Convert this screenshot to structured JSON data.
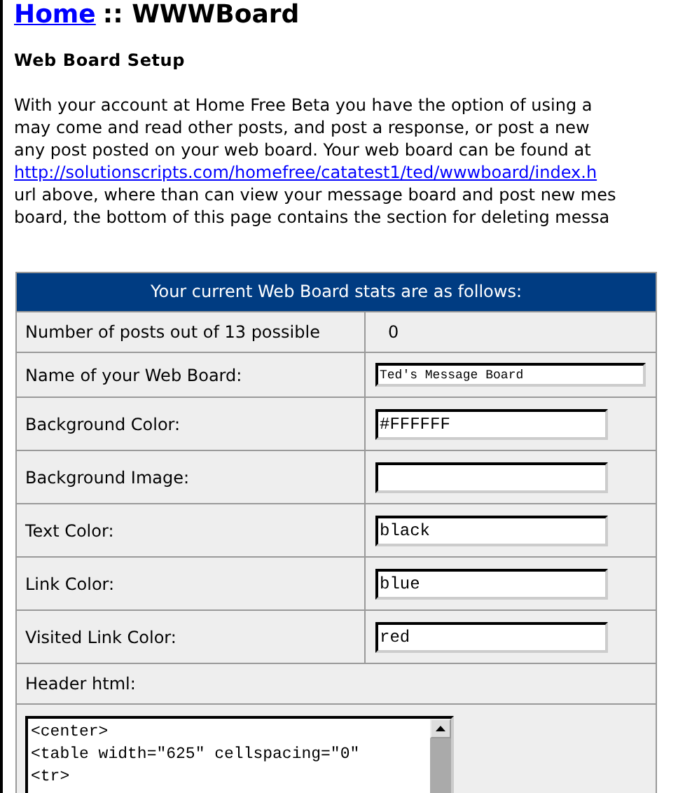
{
  "title": {
    "link": "Home",
    "rest": ":: WWWBoard"
  },
  "heading": "Web Board Setup",
  "intro_lines": [
    {
      "kind": "text",
      "text": "With your account at Home Free Beta you have the option of using a"
    },
    {
      "kind": "text",
      "text": "may come and read other posts, and post a response, or post a new"
    },
    {
      "kind": "text",
      "text": "any post posted on your web board. Your web board can be found at"
    },
    {
      "kind": "link",
      "text": "http://solutionscripts.com/homefree/catatest1/ted/wwwboard/index.h"
    },
    {
      "kind": "text",
      "text": "url above, where than can view your message board and post new mes"
    },
    {
      "kind": "text",
      "text": "board, the bottom of this page contains the section for deleting messa"
    }
  ],
  "table": {
    "header": "Your current Web Board stats are as follows:",
    "rows": [
      {
        "kind": "value",
        "label": "Number of posts out of 13 possible",
        "value": "0"
      },
      {
        "kind": "wide-field",
        "label": "Name of your Web Board:",
        "value": "Ted's Message Board"
      },
      {
        "kind": "field",
        "label": "Background Color:",
        "value": "#FFFFFF"
      },
      {
        "kind": "field",
        "label": "Background Image:",
        "value": ""
      },
      {
        "kind": "field",
        "label": "Text Color:",
        "value": "black"
      },
      {
        "kind": "field",
        "label": "Link Color:",
        "value": "blue"
      },
      {
        "kind": "field",
        "label": "Visited Link Color:",
        "value": "red"
      }
    ],
    "header_html": {
      "label": "Header html:",
      "lines": [
        "<center>",
        "<table width=\"625\" cellspacing=\"0\"",
        "<tr>"
      ]
    }
  }
}
